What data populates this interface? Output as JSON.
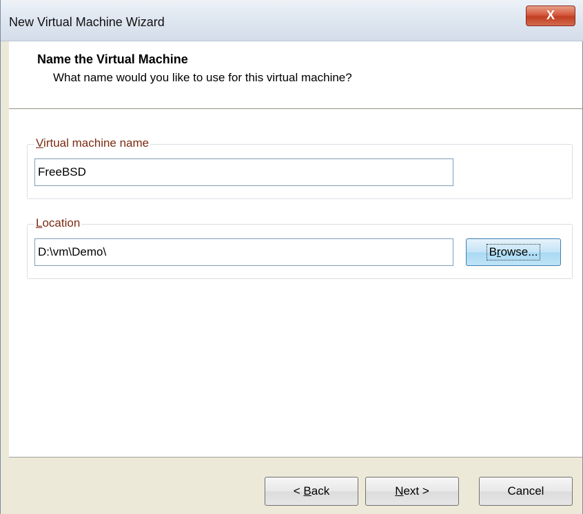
{
  "window": {
    "title": "New Virtual Machine Wizard",
    "close_glyph": "X"
  },
  "header": {
    "title": "Name the Virtual Machine",
    "subtitle": "What name would you like to use for this virtual machine?"
  },
  "name_group": {
    "label_accel": "V",
    "label_rest": "irtual machine name",
    "value": "FreeBSD"
  },
  "location_group": {
    "label_accel": "L",
    "label_rest": "ocation",
    "value": "D:\\vm\\Demo\\",
    "browse_pre": "B",
    "browse_accel": "r",
    "browse_post": "owse..."
  },
  "footer": {
    "back_pre": "< ",
    "back_accel": "B",
    "back_post": "ack",
    "next_accel": "N",
    "next_post": "ext >",
    "cancel_label": "Cancel"
  }
}
